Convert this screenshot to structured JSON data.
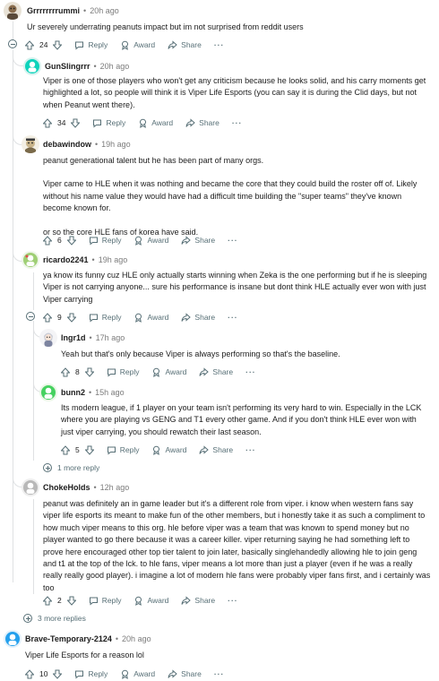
{
  "comments": [
    {
      "username": "Grrrrrrrrummi",
      "time": "20h ago",
      "body": [
        "Ur severely underrating peanuts impact but im not surprised from reddit users"
      ],
      "score": "24",
      "actions": {
        "reply": "Reply",
        "award": "Award",
        "share": "Share"
      }
    },
    {
      "username": "GunSlingrrr",
      "time": "20h ago",
      "body": [
        "Viper is one of those players who won't get any criticism because he looks solid, and his carry moments get highlighted a lot, so people will think it is Viper Life Esports (you can say it is during the Clid days, but not when Peanut went there)."
      ],
      "score": "34",
      "actions": {
        "reply": "Reply",
        "award": "Award",
        "share": "Share"
      }
    },
    {
      "username": "debawindow",
      "time": "19h ago",
      "body": [
        "peanut generational talent but he has been part of many orgs.",
        "Viper came to HLE when it was nothing and became the core that they could build the roster off of. Likely without his name value they would have had a difficult time building the \"super teams\" they've known become known for.",
        "or so the core HLE fans of korea have said."
      ],
      "score": "6",
      "actions": {
        "reply": "Reply",
        "award": "Award",
        "share": "Share"
      }
    },
    {
      "username": "ricardo2241",
      "time": "19h ago",
      "body": [
        "ya know its funny cuz HLE only actually starts winning when Zeka is the one performing but if he is sleeping Viper is not carrying anyone... sure his performance is insane but dont think HLE actually ever won with just Viper carrying"
      ],
      "score": "9",
      "actions": {
        "reply": "Reply",
        "award": "Award",
        "share": "Share"
      }
    },
    {
      "username": "Ingr1d",
      "time": "17h ago",
      "body": [
        "Yeah but that's only because Viper is always performing so that's the baseline."
      ],
      "score": "8",
      "actions": {
        "reply": "Reply",
        "award": "Award",
        "share": "Share"
      }
    },
    {
      "username": "bunn2",
      "time": "15h ago",
      "body": [
        "Its modern league, if 1 player on your team isn't performing its very hard to win. Especially in the LCK where you are playing vs GENG and T1 every other game. And if you don't think HLE ever won with just viper carrying, you should rewatch their last season."
      ],
      "score": "5",
      "actions": {
        "reply": "Reply",
        "award": "Award",
        "share": "Share"
      }
    },
    {
      "username": "ChokeHolds",
      "time": "12h ago",
      "body": [
        "peanut was definitely an in game leader but it's a different role from viper. i know when western fans say viper life esports its meant to make fun of the other members, but i honestly take it as such a compliment to how much viper means to this org. hle before viper was a team that was known to spend money but no player wanted to go there because it was a career killer. viper returning saying he had something left to prove here encouraged other top tier talent to join later, basically singlehandedly allowing hle to join geng and t1 at the top of the lck. to hle fans, viper means a lot more than just a player (even if he was a really really really good player). i imagine a lot of modern hle fans were probably viper fans first, and i certainly was too"
      ],
      "score": "2",
      "actions": {
        "reply": "Reply",
        "award": "Award",
        "share": "Share"
      }
    },
    {
      "username": "Brave-Temporary-2124",
      "time": "20h ago",
      "body": [
        "Viper Life Esports for a reason lol"
      ],
      "score": "10",
      "actions": {
        "reply": "Reply",
        "award": "Award",
        "share": "Share"
      }
    }
  ],
  "more_replies_1": "1 more reply",
  "more_replies_3": "3 more replies",
  "colors": {
    "meta_gray": "#7c7c7c",
    "action_gray": "#576f76",
    "thread_line": "#dfe1e3",
    "avatar_green": "#46d160",
    "avatar_teal": "#24a0ed"
  },
  "icons": [
    "upvote-icon",
    "downvote-icon",
    "reply-icon",
    "award-icon",
    "share-icon",
    "more-options-icon",
    "collapse-icon",
    "expand-icon"
  ]
}
